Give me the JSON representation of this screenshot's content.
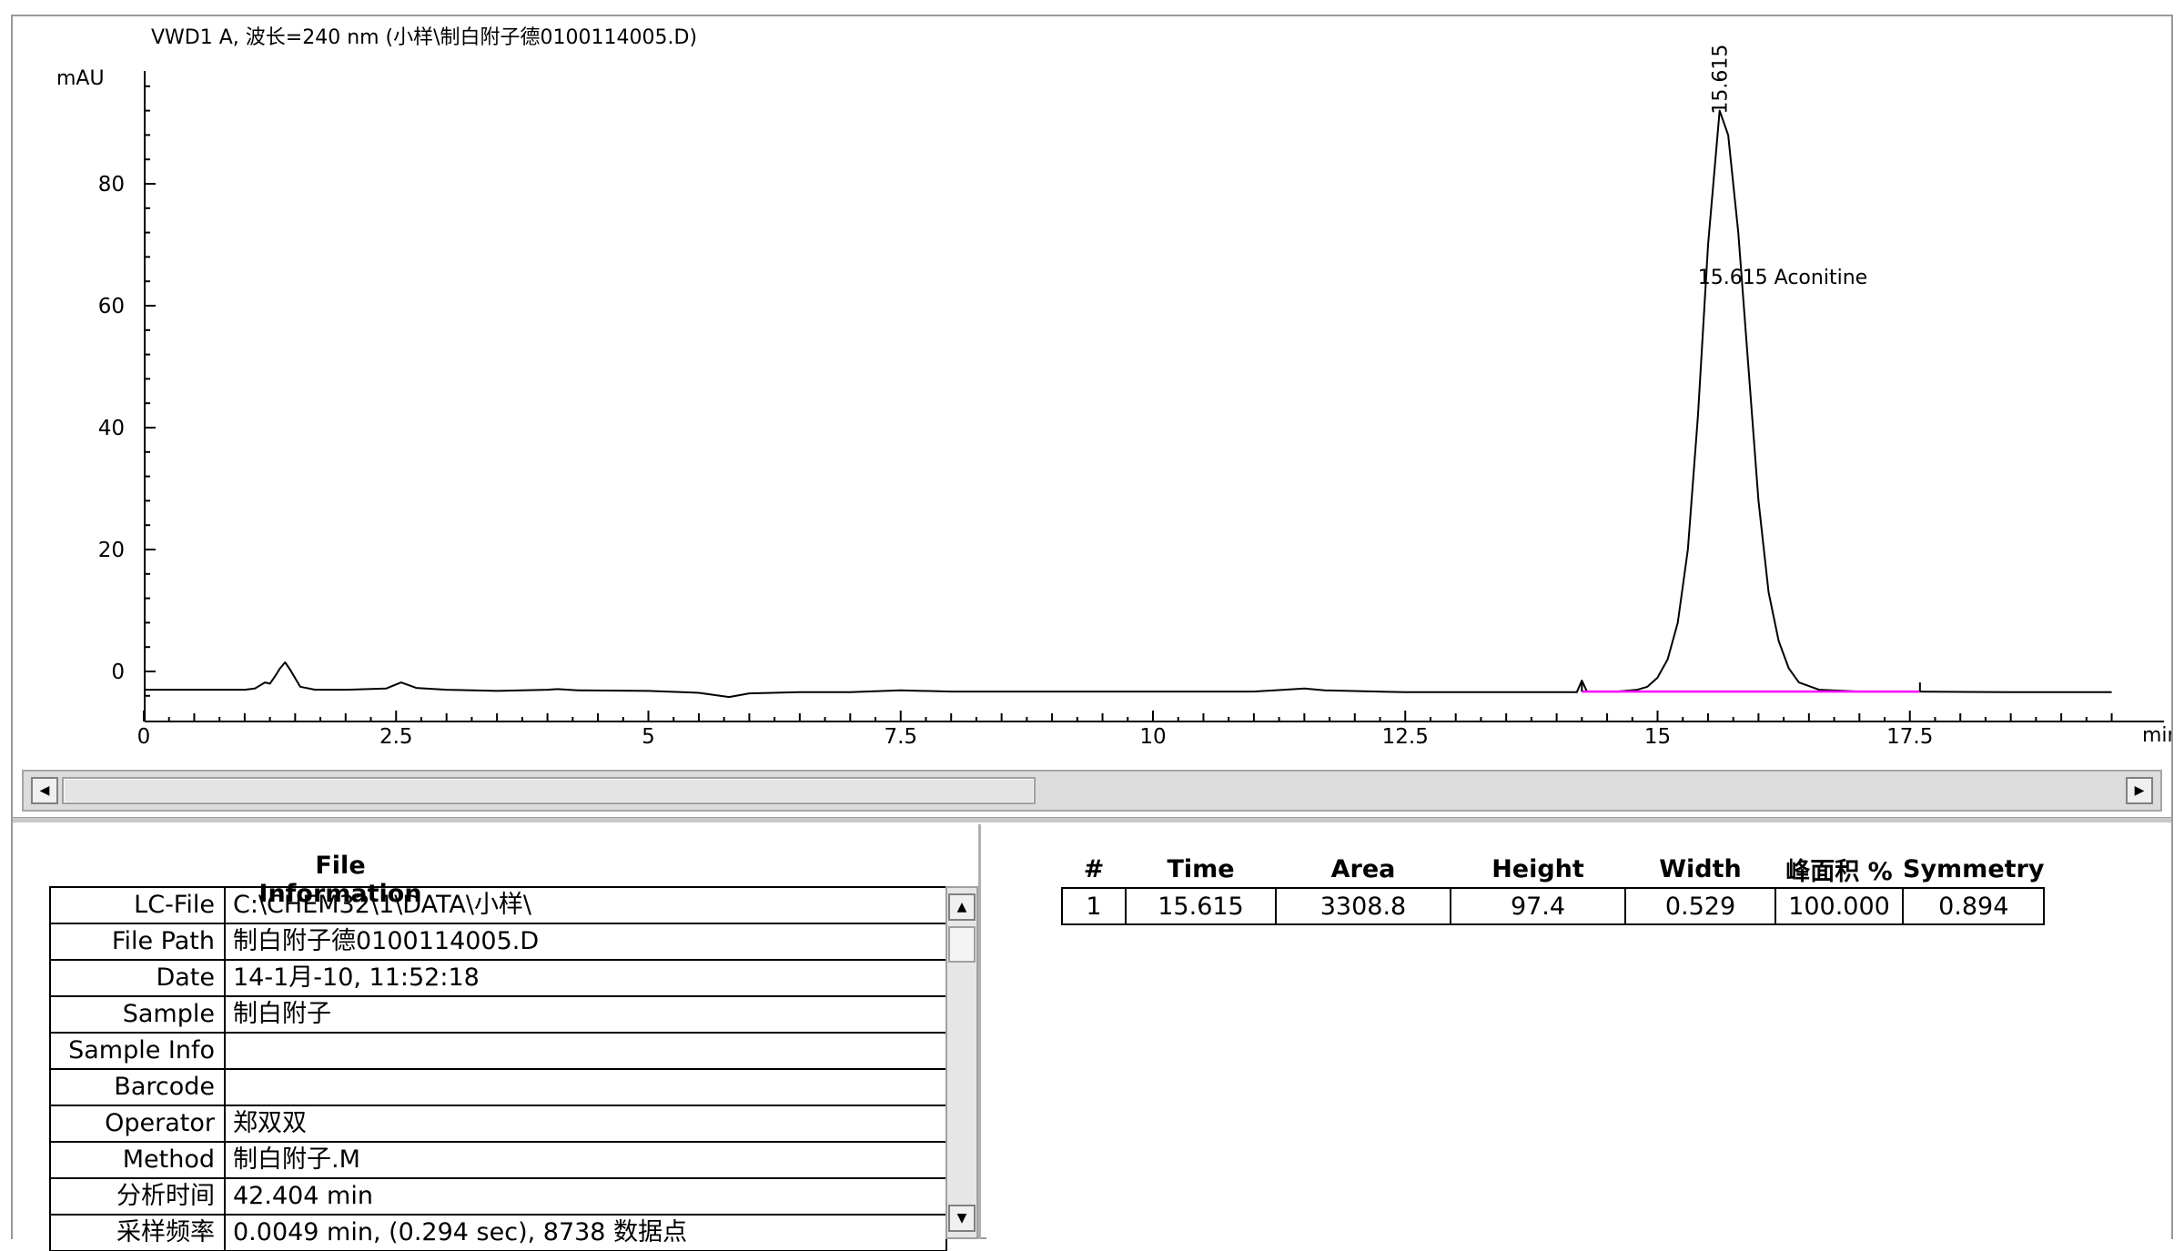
{
  "chart_data": {
    "type": "line",
    "title": "VWD1 A, 波长=240 nm (小样\\制白附子德0100114005.D)",
    "xlabel": "min",
    "ylabel": "mAU",
    "xlim": [
      0,
      19.5
    ],
    "ylim": [
      -5,
      98
    ],
    "x_ticks": [
      "0",
      "2.5",
      "5",
      "7.5",
      "10",
      "12.5",
      "15",
      "17.5"
    ],
    "x_tick_values": [
      0,
      2.5,
      5,
      7.5,
      10,
      12.5,
      15,
      17.5
    ],
    "y_ticks": [
      "0",
      "20",
      "40",
      "60",
      "80"
    ],
    "y_tick_values": [
      0,
      20,
      40,
      60,
      80
    ],
    "series": [
      {
        "color": "#000000",
        "x": [
          0,
          0.5,
          1.0,
          1.1,
          1.2,
          1.25,
          1.3,
          1.35,
          1.4,
          1.45,
          1.55,
          1.7,
          2.0,
          2.4,
          2.55,
          2.7,
          3.0,
          3.5,
          4.0,
          4.1,
          4.3,
          5.0,
          5.5,
          5.8,
          6.0,
          6.5,
          7.0,
          7.5,
          8.0,
          9.0,
          10.0,
          11.0,
          11.5,
          11.7,
          12.5,
          13.5,
          14.2,
          14.25,
          14.3,
          14.6,
          14.8,
          14.9,
          15.0,
          15.1,
          15.2,
          15.3,
          15.4,
          15.5,
          15.615,
          15.7,
          15.8,
          15.9,
          16.0,
          16.1,
          16.2,
          16.3,
          16.4,
          16.6,
          17.0,
          17.5,
          18.5,
          19.5
        ],
        "y": [
          -3,
          -3,
          -3,
          -2.8,
          -1.8,
          -2.0,
          -0.8,
          0.5,
          1.5,
          0.3,
          -2.5,
          -3.0,
          -3.0,
          -2.8,
          -1.8,
          -2.7,
          -3.0,
          -3.2,
          -3.0,
          -2.9,
          -3.1,
          -3.2,
          -3.5,
          -4.2,
          -3.6,
          -3.4,
          -3.4,
          -3.1,
          -3.3,
          -3.3,
          -3.3,
          -3.3,
          -2.8,
          -3.1,
          -3.4,
          -3.4,
          -3.4,
          -1.5,
          -3.3,
          -3.3,
          -3.0,
          -2.5,
          -1.0,
          2.0,
          8.0,
          20.0,
          42.0,
          70.0,
          92.0,
          88.0,
          72.0,
          50.0,
          28.0,
          13.0,
          5.0,
          0.5,
          -1.8,
          -3.0,
          -3.3,
          -3.3,
          -3.4,
          -3.4
        ]
      },
      {
        "name": "baseline",
        "color": "#ff00ff",
        "x": [
          14.25,
          17.6
        ],
        "y": [
          -3.3,
          -3.3
        ]
      }
    ],
    "annotations": [
      {
        "label": "15.615",
        "x": 15.615,
        "y": 92,
        "rotate": true
      },
      {
        "label": "15.615 Aconitine",
        "x": 15.615,
        "y": 68
      }
    ],
    "grid": false,
    "legend": "none"
  },
  "h_scrollbar": {
    "left_arrow": "◀",
    "right_arrow": "▶"
  },
  "file_info": {
    "title": "File Information",
    "rows": [
      {
        "label": "LC-File",
        "value": "C:\\CHEM32\\1\\DATA\\小样\\"
      },
      {
        "label": "File Path",
        "value": "制白附子德0100114005.D"
      },
      {
        "label": "Date",
        "value": "14-1月-10, 11:52:18"
      },
      {
        "label": "Sample",
        "value": "制白附子"
      },
      {
        "label": "Sample Info",
        "value": ""
      },
      {
        "label": "Barcode",
        "value": ""
      },
      {
        "label": "Operator",
        "value": "郑双双"
      },
      {
        "label": "Method",
        "value": "制白附子.M"
      },
      {
        "label": "分析时间",
        "value": "42.404 min"
      },
      {
        "label": "采样频率",
        "value": "0.0049 min, (0.294 sec), 8738 数据点"
      }
    ],
    "scroll_up": "▲",
    "scroll_down": "▼"
  },
  "peak_table": {
    "headers": [
      "#",
      "Time",
      "Area",
      "Height",
      "Width",
      "峰面积 %",
      "Symmetry"
    ],
    "rows": [
      [
        "1",
        "15.615",
        "3308.8",
        "97.4",
        "0.529",
        "100.000",
        "0.894"
      ]
    ]
  }
}
